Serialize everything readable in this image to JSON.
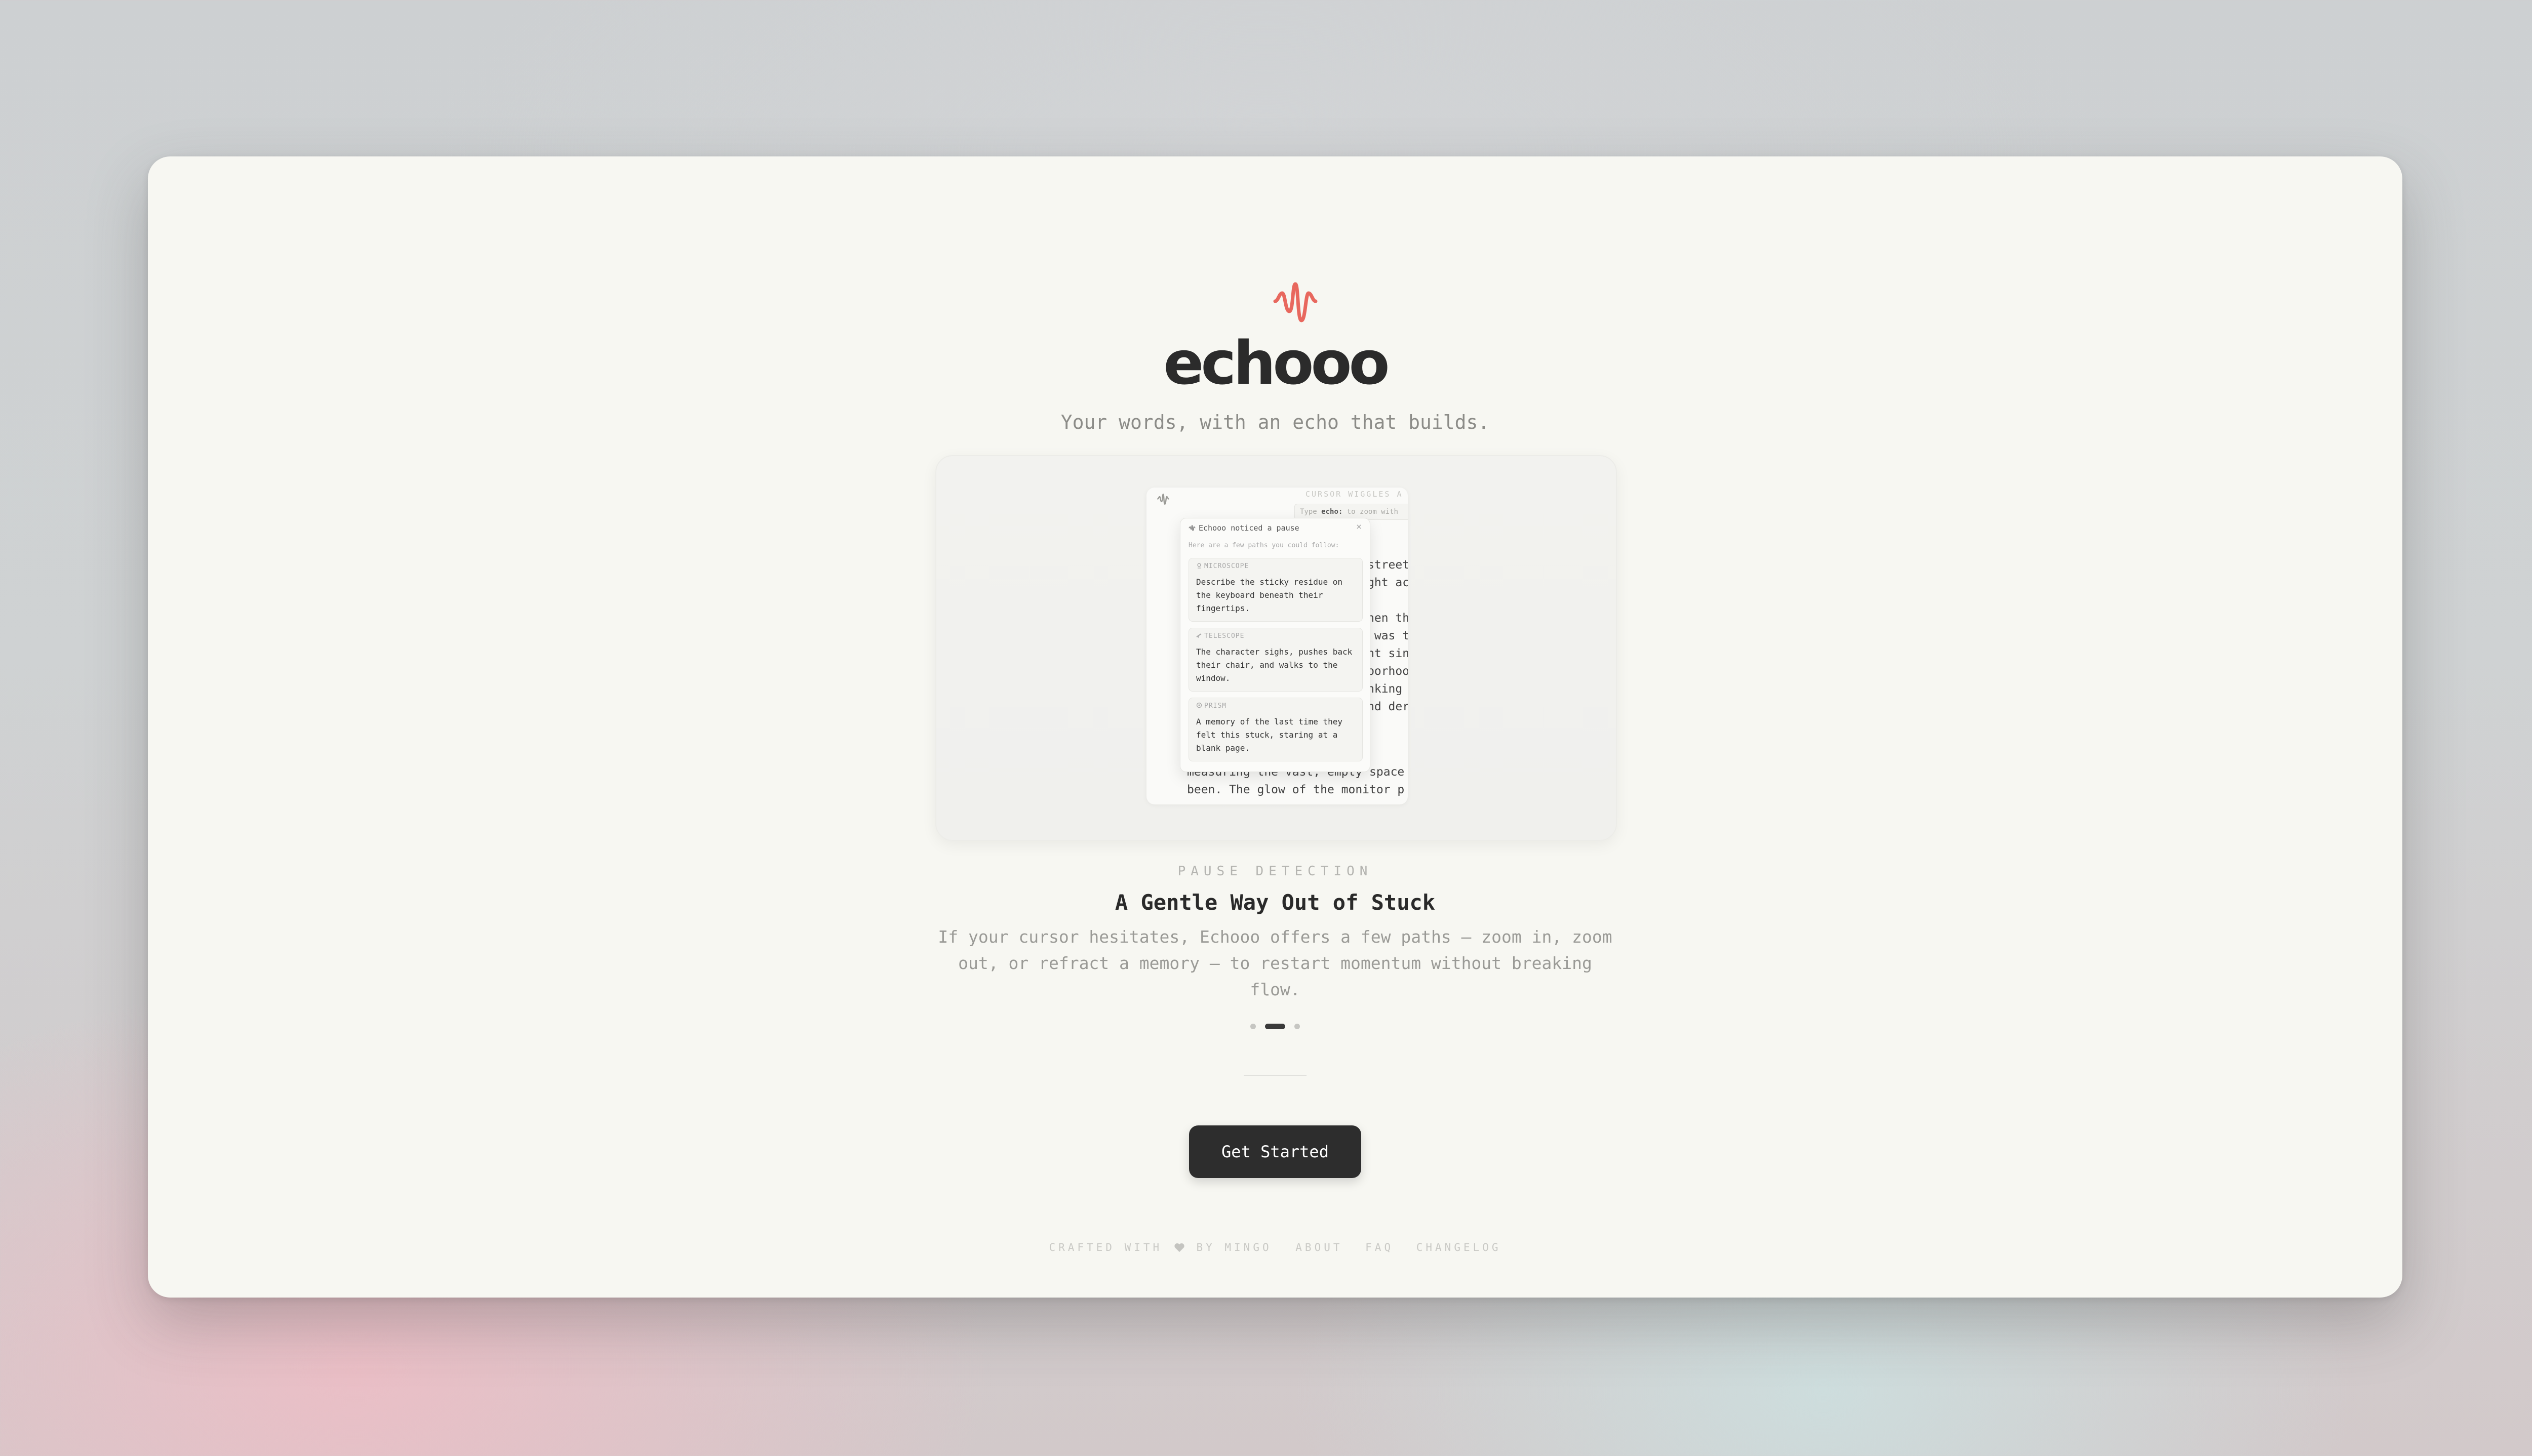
{
  "brand": {
    "name": "echooo",
    "tagline": "Your words, with an echo that builds.",
    "accent_color": "#e8685e",
    "logo_icon": "wave-icon"
  },
  "preview": {
    "hint": "CURSOR WIGGLES A",
    "typebar_prefix": "Type ",
    "typebar_keyword": "echo:",
    "typebar_suffix": " to zoom with",
    "right_text": "street\nght ac\n\nhen th\n was t\nnt sin\nborhoo\nnking\nnd der",
    "bottom_text": "dgment\nmeasuring the vast, empty space\nbeen. The glow of the monitor p",
    "popup": {
      "title": "Echooo noticed a pause",
      "close": "×",
      "subtitle": "Here are a few paths you could follow:",
      "options": [
        {
          "label": "MICROSCOPE",
          "icon": "microscope-icon",
          "text": "Describe the sticky residue on the keyboard beneath their fingertips."
        },
        {
          "label": "TELESCOPE",
          "icon": "telescope-icon",
          "text": "The character sighs, pushes back their chair, and walks to the window."
        },
        {
          "label": "PRISM",
          "icon": "prism-icon",
          "text": "A memory of the last time they felt this stuck, staring at a blank page."
        }
      ]
    }
  },
  "feature": {
    "eyebrow": "PAUSE DETECTION",
    "title": "A Gentle Way Out of Stuck",
    "description": "If your cursor hesitates, Echooo offers a few paths — zoom in, zoom out, or refract a memory — to restart momentum without breaking flow."
  },
  "carousel": {
    "count": 3,
    "active_index": 1
  },
  "cta": {
    "label": "Get Started"
  },
  "footer": {
    "crafted_prefix": "CRAFTED WITH",
    "crafted_suffix": "BY MINGO",
    "links": [
      "ABOUT",
      "FAQ",
      "CHANGELOG"
    ]
  }
}
